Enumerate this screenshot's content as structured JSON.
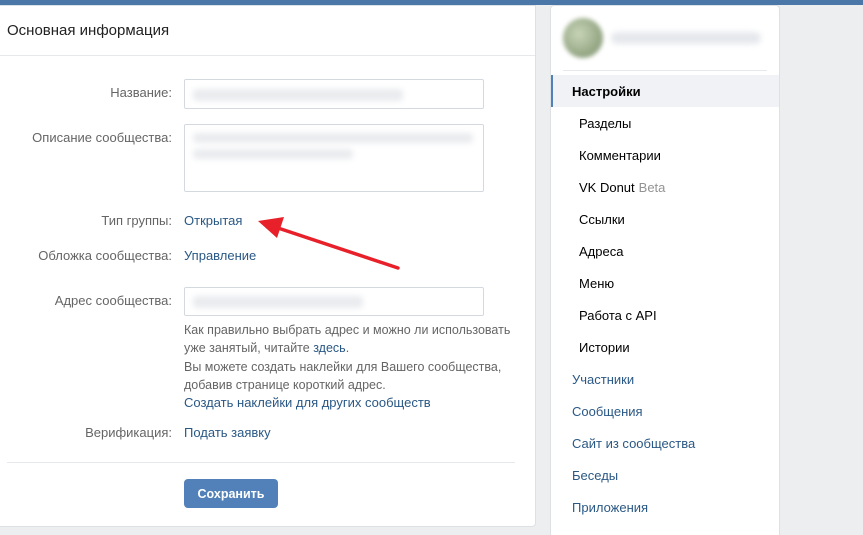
{
  "main": {
    "title": "Основная информация",
    "fields": {
      "name_label": "Название:",
      "description_label": "Описание сообщества:",
      "group_type_label": "Тип группы:",
      "group_type_value": "Открытая",
      "cover_label": "Обложка сообщества:",
      "cover_link": "Управление",
      "address_label": "Адрес сообщества:",
      "address_hint_text": "Как правильно выбрать адрес и можно ли использовать уже занятый, читайте",
      "address_hint_link": "здесь",
      "address_hint_end": ".",
      "stickers_text": "Вы можете создать наклейки для Вашего сообщества, добавив странице короткий адрес.",
      "stickers_link": "Создать наклейки для других сообществ",
      "verification_label": "Верификация:",
      "verification_link": "Подать заявку"
    },
    "save_label": "Сохранить"
  },
  "sidebar": {
    "items": [
      {
        "label": "Настройки",
        "type": "active"
      },
      {
        "label": "Разделы",
        "type": "sub"
      },
      {
        "label": "Комментарии",
        "type": "sub"
      },
      {
        "label": "VK Donut",
        "badge": "Beta",
        "type": "sub"
      },
      {
        "label": "Ссылки",
        "type": "sub"
      },
      {
        "label": "Адреса",
        "type": "sub"
      },
      {
        "label": "Меню",
        "type": "sub"
      },
      {
        "label": "Работа с API",
        "type": "sub"
      },
      {
        "label": "Истории",
        "type": "sub"
      },
      {
        "label": "Участники",
        "type": "top"
      },
      {
        "label": "Сообщения",
        "type": "top"
      },
      {
        "label": "Сайт из сообщества",
        "type": "top"
      },
      {
        "label": "Беседы",
        "type": "top"
      },
      {
        "label": "Приложения",
        "type": "top"
      }
    ]
  },
  "colors": {
    "accent": "#5181b8",
    "link": "#2a5885",
    "annotation_arrow": "#e8202a"
  },
  "icons": {
    "annotation": "red-arrow-icon"
  }
}
